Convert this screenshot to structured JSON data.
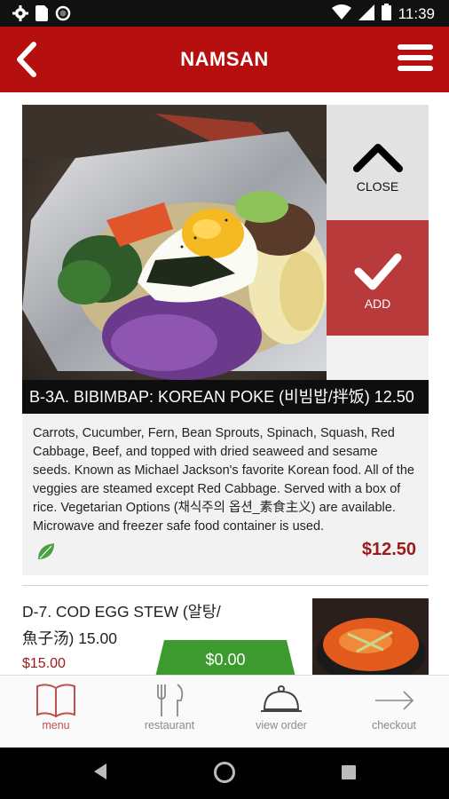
{
  "status_bar": {
    "time": "11:39",
    "icons": [
      "gear-icon",
      "sim-card-icon",
      "circle-icon",
      "wifi-icon",
      "signal-icon",
      "battery-icon"
    ]
  },
  "header": {
    "title": "NAMSAN",
    "back_icon": "chevron-left-icon",
    "menu_icon": "hamburger-menu-icon"
  },
  "featured_item": {
    "title": "B-3A. BIBIMBAP: KOREAN POKE (비빔밥/拌饭) 12.50",
    "description": "Carrots, Cucumber, Fern, Bean Sprouts, Spinach, Squash, Red Cabbage, Beef, and topped with dried seaweed and sesame seeds. Known as Michael Jackson's favorite Korean food. All of the veggies are steamed except Red Cabbage. Served with a box of rice. Vegetarian Options (채식주의 옵션_素食主义) are available. Microwave and freezer safe food container is used.",
    "price": "$12.50",
    "close_label": "CLOSE",
    "add_label": "ADD",
    "badge_icon": "leaf-icon"
  },
  "second_item": {
    "name": "D-7. COD EGG STEW (알탕/魚子汤) 15.00",
    "price": "$15.00"
  },
  "cart": {
    "total": "$0.00"
  },
  "bottom_nav": {
    "items": [
      {
        "label": "menu",
        "icon": "open-book-icon",
        "active": true
      },
      {
        "label": "restaurant",
        "icon": "fork-knife-icon",
        "active": false
      },
      {
        "label": "view order",
        "icon": "cloche-icon",
        "active": false
      },
      {
        "label": "checkout",
        "icon": "arrow-right-icon",
        "active": false
      }
    ]
  },
  "colors": {
    "brand": "#b50f0f",
    "price": "#9c1a1a",
    "add_panel": "#b83a3a",
    "cart_pill": "#3d9a2f",
    "leaf": "#4aa043"
  }
}
